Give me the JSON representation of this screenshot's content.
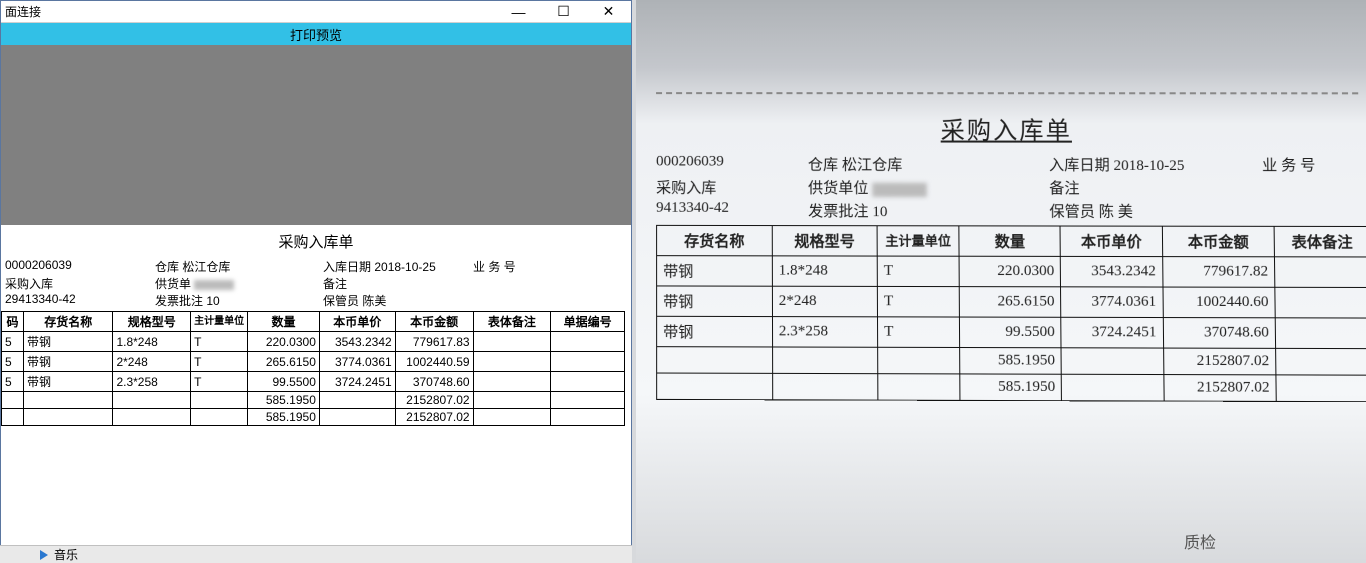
{
  "window": {
    "title": "面连接",
    "toolbar_label": "打印预览",
    "status_label": "音乐"
  },
  "doc": {
    "title": "采购入库单",
    "meta": {
      "no": "0000206039",
      "type": "采购入库",
      "code": "29413340-42",
      "warehouse_label": "仓库",
      "warehouse": "松江仓库",
      "supplier_label": "供货单",
      "invoice_label": "发票批注",
      "invoice": "10",
      "indate_label": "入库日期",
      "indate": "2018-10-25",
      "remark_label": "备注",
      "keeper_label": "保管员",
      "keeper": "陈美",
      "bizno_label": "业 务 号"
    },
    "headers": {
      "code": "码",
      "name": "存货名称",
      "spec": "规格型号",
      "unit": "主计量单位",
      "qty": "数量",
      "price": "本币单价",
      "amount": "本币金额",
      "note": "表体备注",
      "docno": "单据编号"
    },
    "rows": [
      {
        "code": "5",
        "name": "带钢",
        "spec": "1.8*248",
        "unit": "T",
        "qty": "220.0300",
        "price": "3543.2342",
        "amount": "779617.83"
      },
      {
        "code": "5",
        "name": "带钢",
        "spec": "2*248",
        "unit": "T",
        "qty": "265.6150",
        "price": "3774.0361",
        "amount": "1002440.59"
      },
      {
        "code": "5",
        "name": "带钢",
        "spec": "2.3*258",
        "unit": "T",
        "qty": "99.5500",
        "price": "3724.2451",
        "amount": "370748.60"
      }
    ],
    "totals": [
      {
        "qty": "585.1950",
        "amount": "2152807.02"
      },
      {
        "qty": "585.1950",
        "amount": "2152807.02"
      }
    ]
  },
  "photo": {
    "title": "采购入库单",
    "meta": {
      "no": "000206039",
      "type": "采购入库",
      "code": "9413340-42",
      "warehouse_label": "仓库",
      "warehouse": "松江仓库",
      "supplier_label": "供货单位",
      "invoice_label": "发票批注",
      "invoice": "10",
      "indate_label": "入库日期",
      "indate": "2018-10-25",
      "remark_label": "备注",
      "keeper_label": "保管员",
      "keeper": "陈 美",
      "bizno_label": "业 务 号"
    },
    "headers": {
      "name": "存货名称",
      "spec": "规格型号",
      "unit": "主计量单位",
      "qty": "数量",
      "price": "本币单价",
      "amount": "本币金额",
      "note": "表体备注"
    },
    "rows": [
      {
        "name": "带钢",
        "spec": "1.8*248",
        "unit": "T",
        "qty": "220.0300",
        "price": "3543.2342",
        "amount": "779617.82"
      },
      {
        "name": "带钢",
        "spec": "2*248",
        "unit": "T",
        "qty": "265.6150",
        "price": "3774.0361",
        "amount": "1002440.60"
      },
      {
        "name": "带钢",
        "spec": "2.3*258",
        "unit": "T",
        "qty": "99.5500",
        "price": "3724.2451",
        "amount": "370748.60"
      }
    ],
    "totals": [
      {
        "qty": "585.1950",
        "amount": "2152807.02"
      },
      {
        "qty": "585.1950",
        "amount": "2152807.02"
      }
    ],
    "footer_word": "质检"
  }
}
